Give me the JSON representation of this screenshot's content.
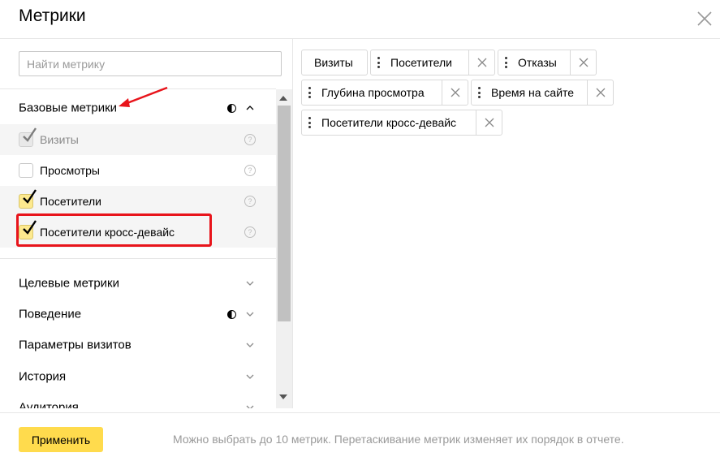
{
  "dialog": {
    "title": "Метрики"
  },
  "search": {
    "placeholder": "Найти метрику",
    "value": ""
  },
  "groups": [
    {
      "label": "Базовые метрики",
      "expanded": true,
      "partial_icon": true
    },
    {
      "label": "Целевые метрики",
      "expanded": false,
      "partial_icon": false
    },
    {
      "label": "Поведение",
      "expanded": false,
      "partial_icon": true
    },
    {
      "label": "Параметры визитов",
      "expanded": false,
      "partial_icon": false
    },
    {
      "label": "История",
      "expanded": false,
      "partial_icon": false
    },
    {
      "label": "Аудитория",
      "expanded": false,
      "partial_icon": false
    }
  ],
  "basic_metrics": [
    {
      "label": "Визиты",
      "checked": true,
      "disabled": true
    },
    {
      "label": "Просмотры",
      "checked": false,
      "disabled": false
    },
    {
      "label": "Посетители",
      "checked": true,
      "disabled": false
    },
    {
      "label": "Посетители кросс-девайс",
      "checked": true,
      "disabled": false
    }
  ],
  "help_glyph": "?",
  "selected_chips": [
    {
      "label": "Визиты",
      "removable": false,
      "draggable": false
    },
    {
      "label": "Посетители",
      "removable": true,
      "draggable": true
    },
    {
      "label": "Отказы",
      "removable": true,
      "draggable": true
    },
    {
      "label": "Глубина просмотра",
      "removable": true,
      "draggable": true
    },
    {
      "label": "Время на сайте",
      "removable": true,
      "draggable": true
    },
    {
      "label": "Посетители кросс-девайс",
      "removable": true,
      "draggable": true
    }
  ],
  "footer": {
    "apply_label": "Применить",
    "hint": "Можно выбрать до 10 метрик. Перетаскивание метрик изменяет их порядок в отчете."
  },
  "colors": {
    "accent": "#ffdb4d",
    "checkbox_checked": "#fde98e",
    "annotation": "#e8141b"
  },
  "icons": [
    "close-icon",
    "chevron-up-icon",
    "chevron-down-icon",
    "half-circle-icon",
    "help-icon",
    "drag-handle-icon",
    "remove-icon",
    "checkmark-icon",
    "annotation-arrow-icon"
  ]
}
